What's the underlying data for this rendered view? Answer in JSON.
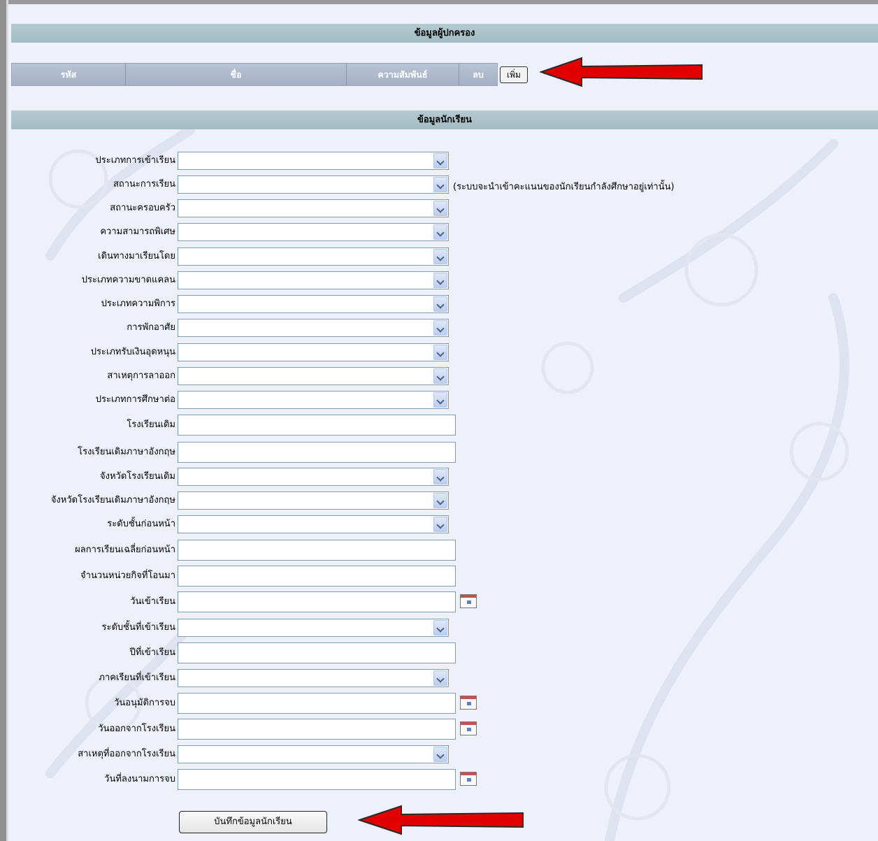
{
  "guardian_section": {
    "title": "ข้อมูลผู้ปกครอง",
    "columns": [
      "รหัส",
      "ชื่อ",
      "ความสัมพันธ์",
      "ลบ"
    ],
    "add_label": "เพิ่ม"
  },
  "student_section": {
    "title": "ข้อมูลนักเรียน",
    "status_note": "(ระบบจะนำเข้าคะแนนของนักเรียนกำลังศึกษาอยู่เท่านั้น)",
    "fields": [
      {
        "label": "ประเภทการเข้าเรียน",
        "type": "select",
        "value": ""
      },
      {
        "label": "สถานะการเรียน",
        "type": "select",
        "value": ""
      },
      {
        "label": "สถานะครอบครัว",
        "type": "select",
        "value": ""
      },
      {
        "label": "ความสามารถพิเศษ",
        "type": "select",
        "value": ""
      },
      {
        "label": "เดินทางมาเรียนโดย",
        "type": "select",
        "value": ""
      },
      {
        "label": "ประเภทความขาดแคลน",
        "type": "select",
        "value": ""
      },
      {
        "label": "ประเภทความพิการ",
        "type": "select",
        "value": ""
      },
      {
        "label": "การพักอาศัย",
        "type": "select",
        "value": ""
      },
      {
        "label": "ประเภทรับเงินอุดหนุน",
        "type": "select",
        "value": ""
      },
      {
        "label": "สาเหตุการลาออก",
        "type": "select",
        "value": ""
      },
      {
        "label": "ประเภทการศึกษาต่อ",
        "type": "select",
        "value": ""
      },
      {
        "label": "โรงเรียนเดิม",
        "type": "text",
        "value": ""
      },
      {
        "label": "โรงเรียนเดิมภาษาอังกฤษ",
        "type": "text",
        "value": ""
      },
      {
        "label": "จังหวัดโรงเรียนเดิม",
        "type": "select",
        "value": ""
      },
      {
        "label": "จังหวัดโรงเรียนเดิมภาษาอังกฤษ",
        "type": "select",
        "value": ""
      },
      {
        "label": "ระดับชั้นก่อนหน้า",
        "type": "select",
        "value": ""
      },
      {
        "label": "ผลการเรียนเฉลี่ยก่อนหน้า",
        "type": "text",
        "value": ""
      },
      {
        "label": "จำนวนหน่วยกิจที่โอนมา",
        "type": "text",
        "value": ""
      },
      {
        "label": "วันเข้าเรียน",
        "type": "date",
        "value": "",
        "icon": "calendar-icon"
      },
      {
        "label": "ระดับชั้นที่เข้าเรียน",
        "type": "select",
        "value": ""
      },
      {
        "label": "ปีที่เข้าเรียน",
        "type": "text",
        "value": ""
      },
      {
        "label": "ภาคเรียนที่เข้าเรียน",
        "type": "select",
        "value": ""
      },
      {
        "label": "วันอนุมัติการจบ",
        "type": "date",
        "value": "",
        "icon": "calendar-icon"
      },
      {
        "label": "วันออกจากโรงเรียน",
        "type": "date",
        "value": "",
        "icon": "calendar-icon"
      },
      {
        "label": "สาเหตุที่ออกจากโรงเรียน",
        "type": "select",
        "value": ""
      },
      {
        "label": "วันที่ลงนามการจบ",
        "type": "date",
        "value": "",
        "icon": "calendar-icon"
      }
    ],
    "save_label": "บันทึกข้อมูลนักเรียน"
  },
  "colors": {
    "section_header": "#a9c1c8",
    "table_header": "#b0bace",
    "annotation_arrow": "#e00000",
    "background": "#eef1fa"
  }
}
